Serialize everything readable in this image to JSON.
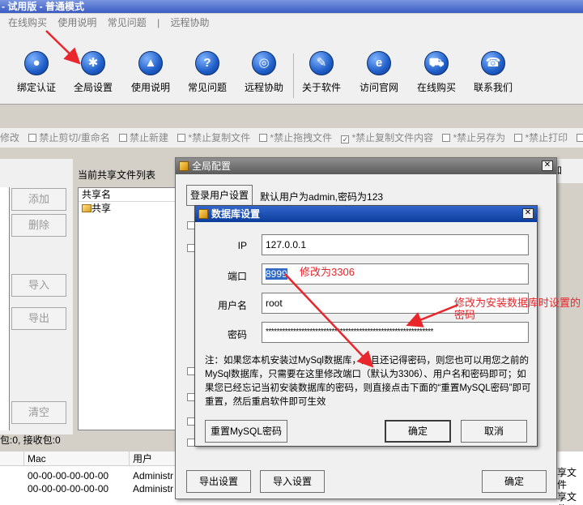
{
  "window": {
    "title": "- 试用版 - 普通模式"
  },
  "menu": [
    "在线购买",
    "使用说明",
    "常见问题",
    "|",
    "远程协助"
  ],
  "toolbar": [
    {
      "label": "绑定认证",
      "icon": "globe-icon",
      "glyph": "●"
    },
    {
      "label": "全局设置",
      "icon": "gear-icon",
      "glyph": "✱"
    },
    {
      "label": "使用说明",
      "icon": "graduation-cap-icon",
      "glyph": "▲"
    },
    {
      "label": "常见问题",
      "icon": "question-icon",
      "glyph": "?"
    },
    {
      "label": "远程协助",
      "icon": "network-icon",
      "glyph": "◎"
    },
    {
      "label": "关于软件",
      "icon": "document-icon",
      "glyph": "✎"
    },
    {
      "label": "访问官网",
      "icon": "browser-icon",
      "glyph": "e"
    },
    {
      "label": "在线购买",
      "icon": "cart-icon",
      "glyph": "⛟"
    },
    {
      "label": "联系我们",
      "icon": "phone-icon",
      "glyph": "☎"
    }
  ],
  "options": {
    "lead": "修改",
    "items": [
      {
        "label": "禁止剪切/重命名",
        "checked": false
      },
      {
        "label": "禁止新建",
        "checked": false
      },
      {
        "label": "*禁止复制文件",
        "checked": false
      },
      {
        "label": "*禁止拖拽文件",
        "checked": false
      },
      {
        "label": "*禁止复制文件内容",
        "checked": true
      },
      {
        "label": "*禁止另存为",
        "checked": false
      },
      {
        "label": "*禁止打印",
        "checked": false
      },
      {
        "label": "禁",
        "checked": false
      }
    ]
  },
  "side_buttons": [
    "添加",
    "删除",
    "导入",
    "导出",
    "清空"
  ],
  "share_list": {
    "title": "当前共享文件列表",
    "header": "共享名",
    "rows": [
      "共享"
    ]
  },
  "status_text": "包:0, 接收包:0",
  "bottom_table": {
    "columns": [
      "Mac",
      "用户"
    ],
    "rows": [
      {
        "mac": "00-00-00-00-00-00",
        "user": "Administr"
      },
      {
        "mac": "00-00-00-00-00-00",
        "user": "Administr"
      }
    ]
  },
  "right_fragment": {
    "top_label": "加",
    "cells": [
      "享文件",
      "享文件"
    ]
  },
  "global_dialog": {
    "title": "全局配置",
    "login_button": "登录用户设置",
    "login_info": "默认用户为admin,密码为123",
    "export_button": "导出设置",
    "import_button": "导入设置",
    "ok_button": "确定"
  },
  "db_dialog": {
    "title": "数据库设置",
    "fields": [
      {
        "label": "IP",
        "value": "127.0.0.1"
      },
      {
        "label": "端口",
        "value": "8999"
      },
      {
        "label": "用户名",
        "value": "root"
      },
      {
        "label": "密码",
        "value": "*************************************************************"
      }
    ],
    "note": "注：如果您本机安装过MySql数据库，并且还记得密码，则您也可以用您之前的MySql数据库，只需要在这里修改端口（默认为3306）、用户名和密码即可；如果您已经忘记当初安装数据库的密码，则直接点击下面的“重置MySQL密码”即可重置，然后重启软件即可生效",
    "reset_button": "重置MySQL密码",
    "ok_button": "确定",
    "cancel_button": "取消"
  },
  "annotations": {
    "port": "修改为3306",
    "password": "修改为安装数据库时设置的密码"
  },
  "colors": {
    "annotation": "#e8262b",
    "db_title_bar": "#0a3d9a",
    "selection": "#316ac5"
  }
}
